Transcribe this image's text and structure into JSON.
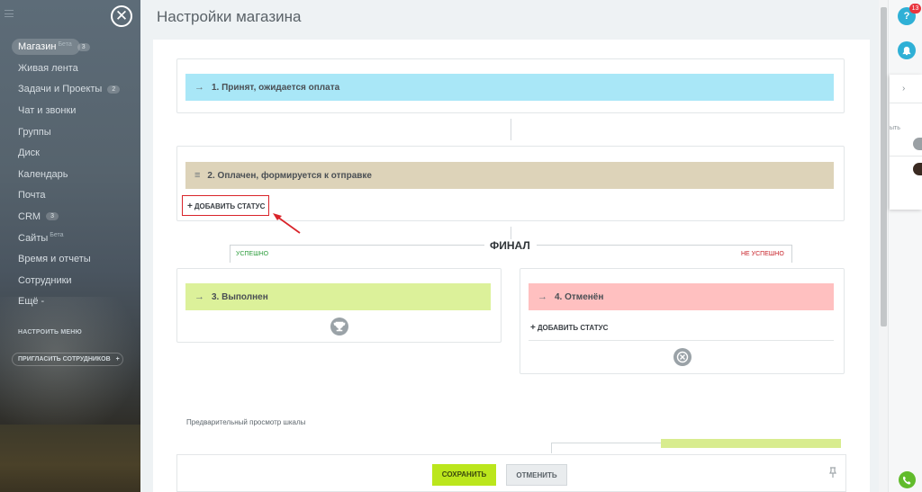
{
  "sidebar": {
    "close_label": "✕",
    "items": [
      {
        "label": "Магазин",
        "beta": "Бета",
        "counter": "3"
      },
      {
        "label": "Живая лента"
      },
      {
        "label": "Задачи и Проекты",
        "counter": "2"
      },
      {
        "label": "Чат и звонки"
      },
      {
        "label": "Группы"
      },
      {
        "label": "Диск"
      },
      {
        "label": "Календарь"
      },
      {
        "label": "Почта"
      },
      {
        "label": "CRM",
        "counter": "3"
      },
      {
        "label": "Сайты",
        "beta": "Бета"
      },
      {
        "label": "Время и отчеты"
      },
      {
        "label": "Сотрудники"
      },
      {
        "label": "Ещё -"
      }
    ],
    "configure_menu": "НАСТРОИТЬ МЕНЮ",
    "invite": "ПРИГЛАСИТЬ СОТРУДНИКОВ",
    "invite_plus": "+"
  },
  "page": {
    "title": "Настройки магазина"
  },
  "statuses": {
    "s1": {
      "arrow": "→",
      "label": "1. Принят, ожидается оплата",
      "color": "#a9e7f7"
    },
    "s2": {
      "drag": "≡",
      "label": "2. Оплачен, формируется к отправке",
      "color": "#ddd3b9"
    },
    "s3": {
      "arrow": "→",
      "label": "3. Выполнен",
      "color": "#dcf19a"
    },
    "s4": {
      "arrow": "→",
      "label": "4. Отменён",
      "color": "#ffc0c0"
    }
  },
  "add_status": {
    "plus": "+",
    "label": "ДОБАВИТЬ СТАТУС"
  },
  "final": {
    "title": "ФИНАЛ",
    "success": "УСПЕШНО",
    "fail": "НЕ УСПЕШНО"
  },
  "preview": {
    "label": "Предварительный просмотр шкалы"
  },
  "footer": {
    "save": "СОХРАНИТЬ",
    "cancel": "ОТМЕНИТЬ"
  },
  "right_panel": {
    "help": "?",
    "help_badge": "13",
    "popup_text": "ыть"
  }
}
